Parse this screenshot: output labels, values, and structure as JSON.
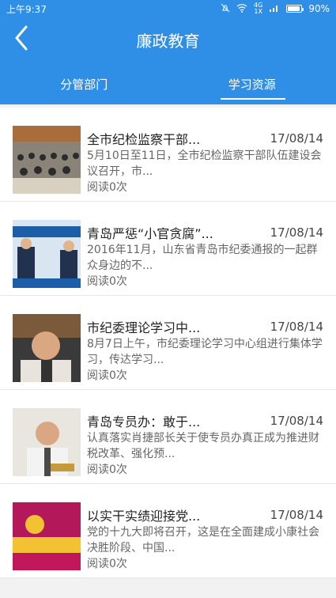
{
  "status": {
    "time": "上午9:37",
    "signal_top": "4G",
    "signal_bottom": "1X",
    "battery_text": "90%",
    "battery_level": 0.9
  },
  "header": {
    "title": "廉政教育",
    "back_icon": "back-chevron-icon"
  },
  "tabs": [
    {
      "label": "分管部门"
    },
    {
      "label": "学习资源"
    }
  ],
  "active_tab": 1,
  "items": [
    {
      "title": "全市纪检监察干部...",
      "date": "17/08/14",
      "summary": "5月10日至11日，全市纪检监察干部队伍建设会议召开，市...",
      "reads": "阅读0次"
    },
    {
      "title": "青岛严惩“小官贪腐”...",
      "date": "17/08/14",
      "summary": "2016年11月，山东省青岛市纪委通报的一起群众身边的不...",
      "reads": "阅读0次"
    },
    {
      "title": "市纪委理论学习中...",
      "date": "17/08/14",
      "summary": "8月7日上午，市纪委理论学习中心组进行集体学习，传达学习...",
      "reads": "阅读0次"
    },
    {
      "title": "青岛专员办：敢于...",
      "date": "17/08/14",
      "summary": "认真落实肖捷部长关于使专员办真正成为推进财税改革、强化预...",
      "reads": "阅读0次"
    },
    {
      "title": "以实干实绩迎接党...",
      "date": "17/08/14",
      "summary": "党的十九大即将召开，这是在全面建成小康社会决胜阶段、中国...",
      "reads": "阅读0次"
    }
  ],
  "colors": {
    "primary": "#2f8fe6"
  }
}
